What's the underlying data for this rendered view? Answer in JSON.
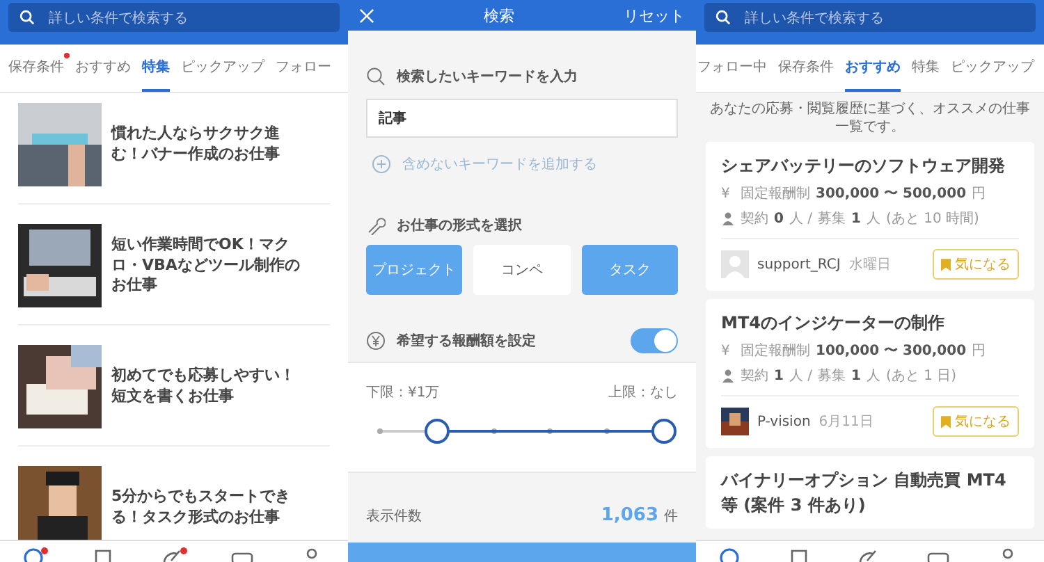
{
  "feature_screen": {
    "search": {
      "placeholder": "詳しい条件で検索する"
    },
    "tabs": [
      {
        "label": "保存条件",
        "selected": false,
        "badge": true
      },
      {
        "label": "おすすめ",
        "selected": false,
        "badge": false
      },
      {
        "label": "特集",
        "selected": true,
        "badge": false
      },
      {
        "label": "ピックアップ",
        "selected": false,
        "badge": false
      },
      {
        "label": "フォロー",
        "selected": false,
        "badge": false
      }
    ],
    "articles": [
      {
        "title": "慣れた人ならサクサク進む！バナー作成のお仕事"
      },
      {
        "title": "短い作業時間でOK！マクロ・VBAなどツール制作のお仕事"
      },
      {
        "title": "初めてでも応募しやすい！短文を書くお仕事"
      },
      {
        "title": "5分からでもスタートできる！タスク形式のお仕事"
      }
    ],
    "nav": [
      {
        "kind": "search",
        "selected": true,
        "badge": true
      },
      {
        "kind": "bookmark",
        "selected": false,
        "badge": false
      },
      {
        "kind": "edit",
        "selected": false,
        "badge": true
      },
      {
        "kind": "chat",
        "selected": false,
        "badge": false
      },
      {
        "kind": "person",
        "selected": false,
        "badge": false
      }
    ]
  },
  "search_screen": {
    "title": "検索",
    "reset": "リセット",
    "keyword_label": "検索したいキーワードを入力",
    "keyword_value": "記事",
    "exclude_link": "含めないキーワードを追加する",
    "type_label": "お仕事の形式を選択",
    "types": [
      {
        "label": "プロジェクト",
        "selected": true
      },
      {
        "label": "コンペ",
        "selected": false
      },
      {
        "label": "タスク",
        "selected": true
      }
    ],
    "reward_label": "希望する報酬額を設定",
    "reward_on": true,
    "lower_label": "下限：¥1万",
    "upper_label": "上限：なし",
    "range": {
      "low": {
        "level": 0.2
      },
      "high": {
        "level": 1
      }
    },
    "count_label": "表示件数",
    "count": "1,063",
    "count_unit": "件"
  },
  "recommend_screen": {
    "search": {
      "placeholder": "詳しい条件で検索する"
    },
    "tabs": [
      {
        "label": "フォロー中",
        "selected": false
      },
      {
        "label": "保存条件",
        "selected": false
      },
      {
        "label": "おすすめ",
        "selected": true
      },
      {
        "label": "特集",
        "selected": false
      },
      {
        "label": "ピックアップ",
        "selected": false
      }
    ],
    "caption": "あなたの応募・閲覧履歴に基づく、オススメの仕事一覧です。",
    "jobs": [
      {
        "title": "シェアバッテリーのソフトウェア開発",
        "yen": "¥",
        "pay_type": "固定報酬制",
        "pay": "300,000 〜 500,000",
        "pay_unit": "円",
        "contract_label": "契約",
        "contracts": "0",
        "contract_unit": "人 /",
        "recruit_label": "募集",
        "recruits": "1",
        "recruit_unit": "人",
        "remaining": "(あと 10 時間)",
        "user": "support_RCJ",
        "date": "水曜日",
        "avatar": {
          "kind": "blank"
        },
        "save": "気になる"
      },
      {
        "title": "MT4のインジケーターの制作",
        "yen": "¥",
        "pay_type": "固定報酬制",
        "pay": "100,000 〜 300,000",
        "pay_unit": "円",
        "contract_label": "契約",
        "contracts": "1",
        "contract_unit": "人 /",
        "recruit_label": "募集",
        "recruits": "1",
        "recruit_unit": "人",
        "remaining": "(あと 1 日)",
        "user": "P-vision",
        "date": "6月11日",
        "save": "気になる"
      },
      {
        "title": "バイナリーオプション 自動売買 MT4等 (案件 3 件あり)"
      }
    ],
    "nav": [
      {
        "kind": "search",
        "selected": true
      },
      {
        "kind": "bookmark",
        "selected": false
      },
      {
        "kind": "edit",
        "selected": false
      },
      {
        "kind": "chat",
        "selected": false
      },
      {
        "kind": "person",
        "selected": false
      }
    ]
  }
}
